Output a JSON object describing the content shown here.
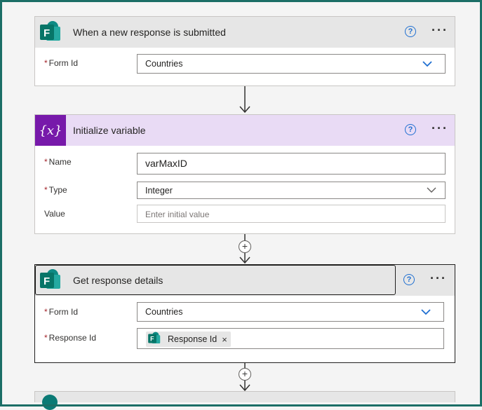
{
  "cards": [
    {
      "title": "When a new response is submitted",
      "fields": [
        {
          "label": "Form Id",
          "required": "*",
          "value": "Countries"
        }
      ]
    },
    {
      "title": "Initialize variable",
      "icon_text": "{x}",
      "fields": [
        {
          "label": "Name",
          "required": "*",
          "value": "varMaxID"
        },
        {
          "label": "Type",
          "required": "*",
          "value": "Integer"
        },
        {
          "label": "Value",
          "placeholder": "Enter initial value"
        }
      ]
    },
    {
      "title": "Get response details",
      "fields": [
        {
          "label": "Form Id",
          "required": "*",
          "value": "Countries"
        },
        {
          "label": "Response Id",
          "required": "*",
          "token": "Response Id",
          "token_remove": "×"
        }
      ]
    }
  ],
  "controls": {
    "help": "?",
    "more": "···",
    "plus": "+"
  },
  "colors": {
    "forms_brand": "#0b7a75",
    "variable_brand": "#7719aa",
    "variable_header": "#e9dbf5",
    "help_accent": "#1f6fd1",
    "frame": "#1b6e66"
  },
  "icons": {
    "forms": "microsoft-forms-icon",
    "variable": "variable-icon",
    "help": "help-icon",
    "more": "more-options-icon",
    "dropdown": "chevron-down-icon",
    "add": "add-step-icon"
  }
}
